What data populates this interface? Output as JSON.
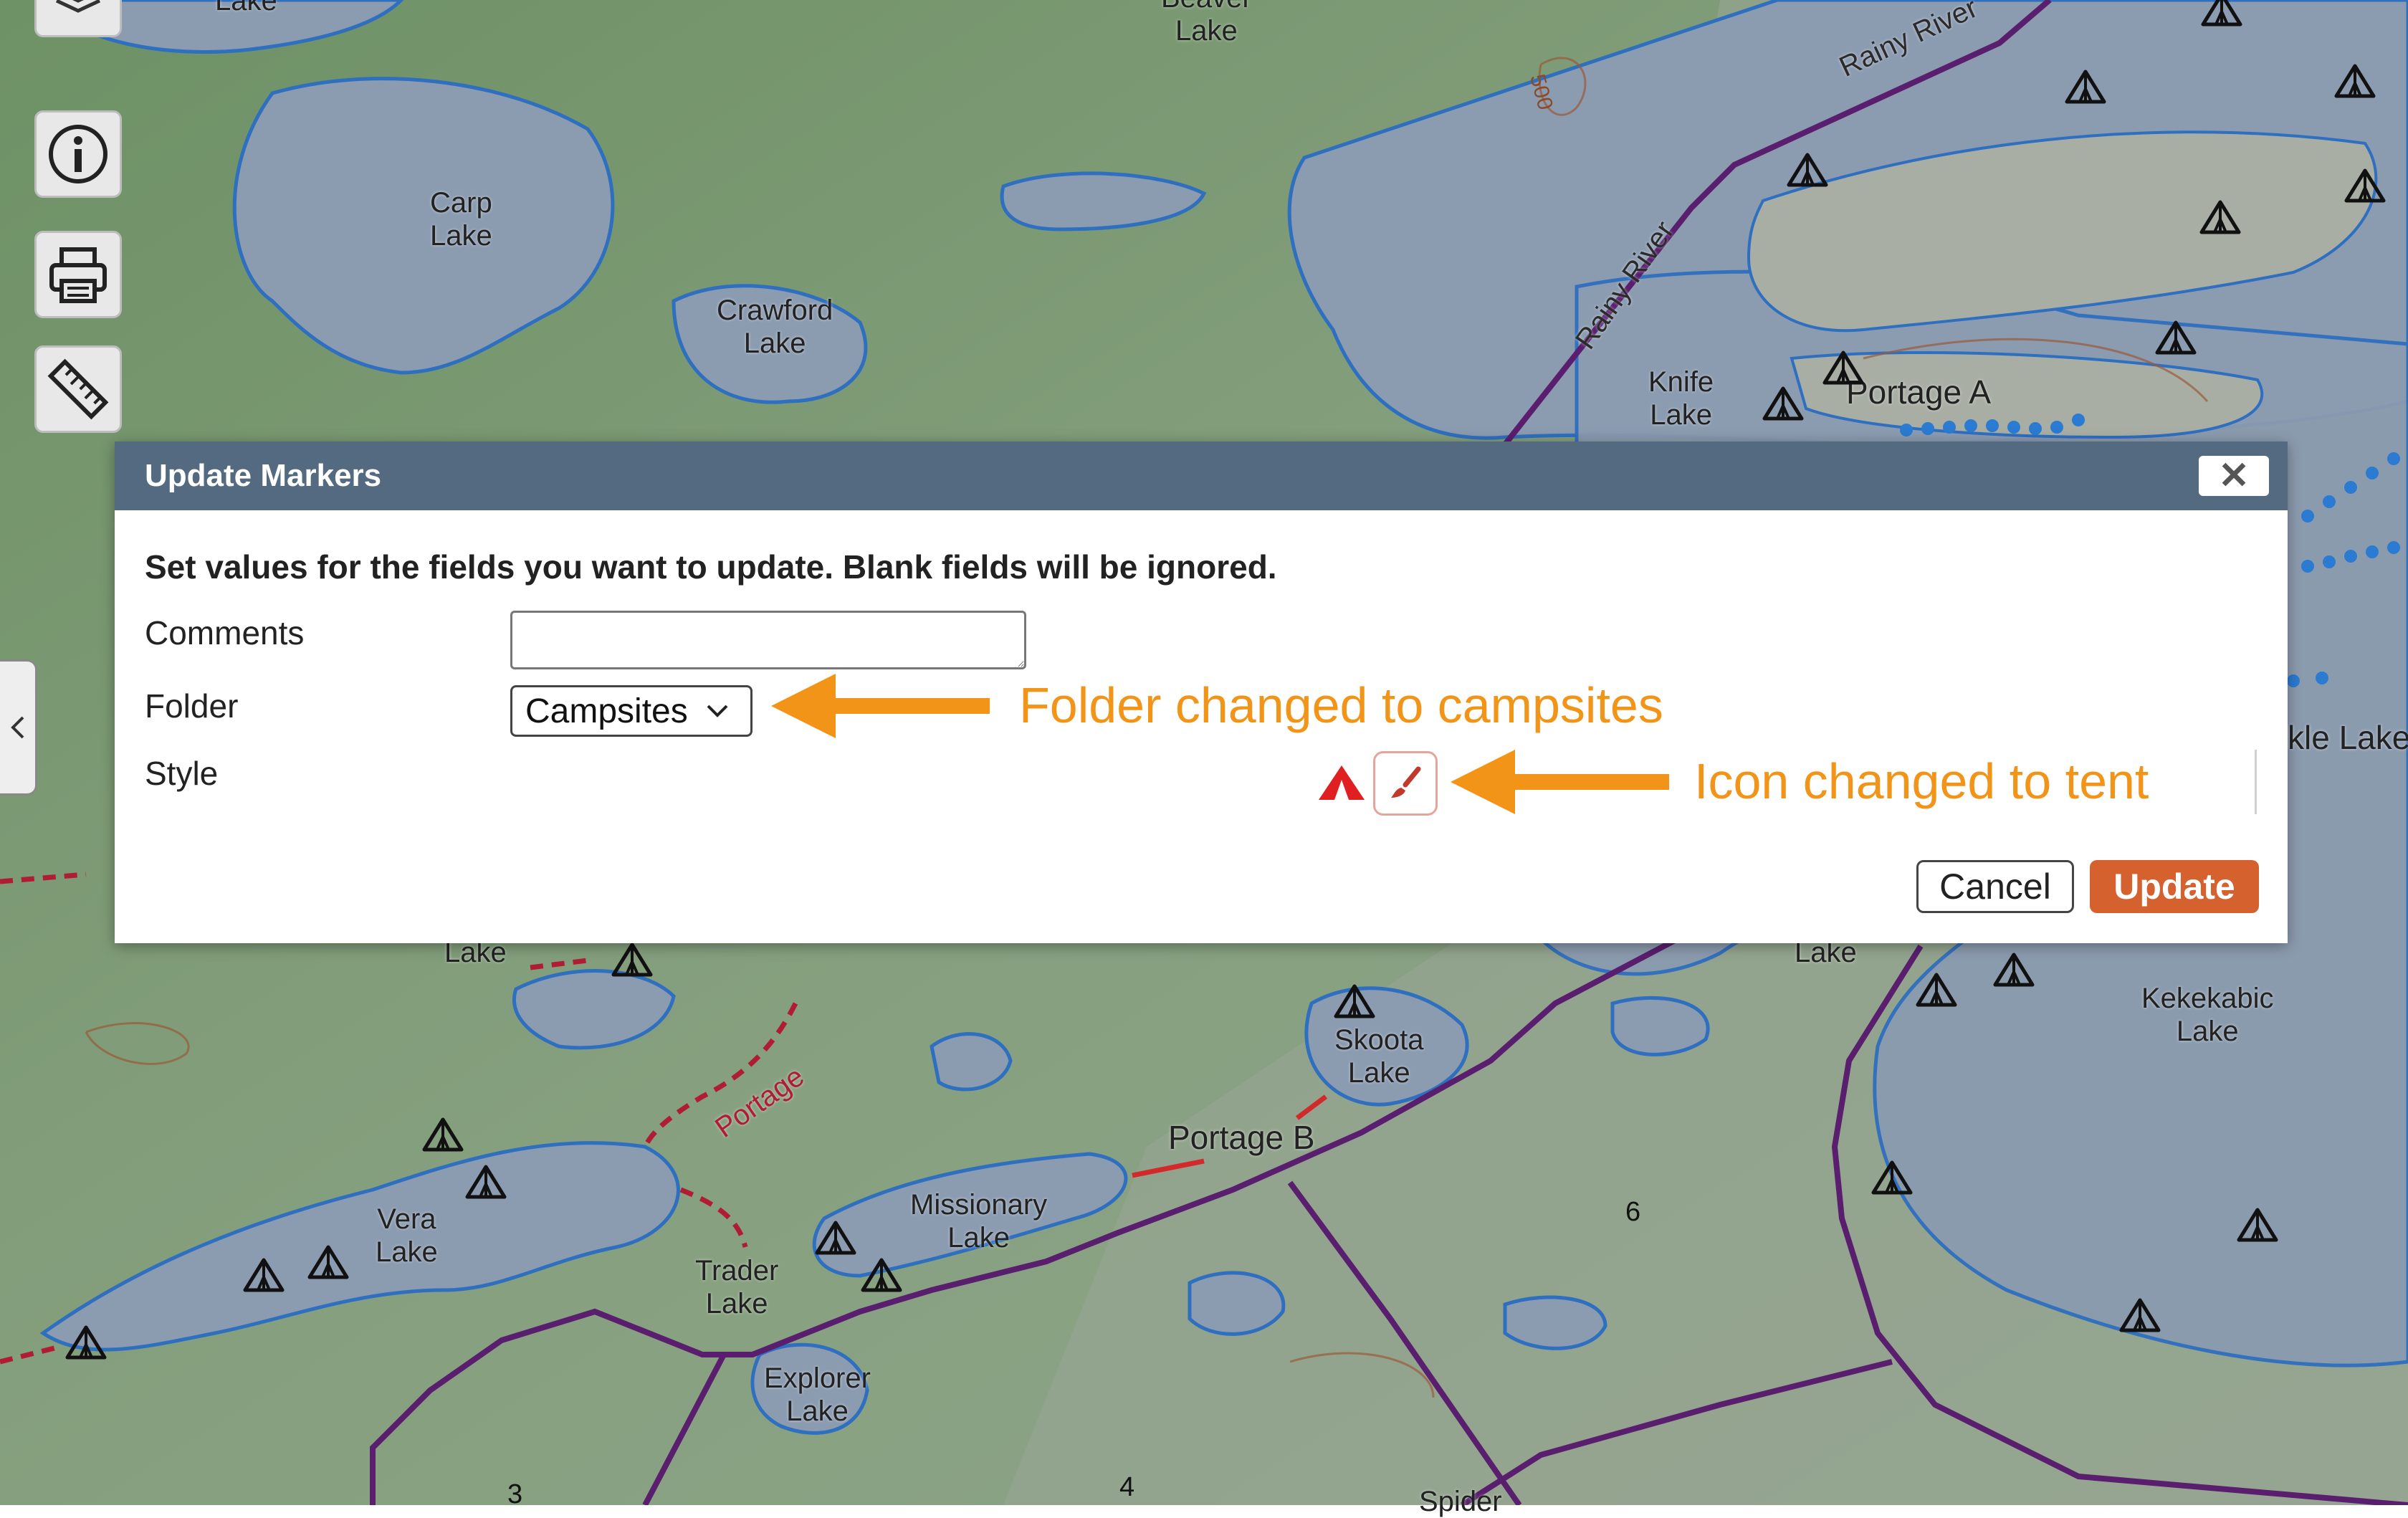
{
  "map": {
    "lake_labels": [
      {
        "id": "lake-beaver",
        "text": "Beaver\nLake"
      },
      {
        "id": "lake-top-left",
        "text": "Lake"
      },
      {
        "id": "lake-carp",
        "text": "Carp\nLake"
      },
      {
        "id": "lake-crawford",
        "text": "Crawford\nLake"
      },
      {
        "id": "lake-knife",
        "text": "Knife\nLake"
      },
      {
        "id": "lake-left-mid",
        "text": "Lake"
      },
      {
        "id": "lake-right-mid",
        "text": "Lake"
      },
      {
        "id": "lake-kekekabic",
        "text": "Kekekabic\nLake"
      },
      {
        "id": "lake-skoota",
        "text": "Skoota\nLake"
      },
      {
        "id": "lake-vera",
        "text": "Vera\nLake"
      },
      {
        "id": "lake-missionary",
        "text": "Missionary\nLake"
      },
      {
        "id": "lake-trader",
        "text": "Trader\nLake"
      },
      {
        "id": "lake-explorer",
        "text": "Explorer\nLake"
      },
      {
        "id": "lake-spider",
        "text": "Spider"
      },
      {
        "id": "lake-partial-right",
        "text": "kle Lake"
      }
    ],
    "river_labels": [
      "Rainy River",
      "Rainy River"
    ],
    "contour_label": "500",
    "portage_a": "Portage A",
    "portage_b": "Portage B",
    "portage_trail": "Portage",
    "section_numbers": [
      "6",
      "3",
      "4"
    ]
  },
  "controls": {
    "layers_icon": "layers-icon",
    "info_icon": "info-icon",
    "print_icon": "printer-icon",
    "measure_icon": "ruler-icon",
    "side_toggle_icon": "chevron-left-icon"
  },
  "dialog": {
    "title": "Update Markers",
    "close_label": "✕",
    "instructions": "Set values for the fields you want to update. Blank fields will be ignored.",
    "fields": {
      "comments_label": "Comments",
      "comments_value": "",
      "folder_label": "Folder",
      "folder_value": "Campsites",
      "style_label": "Style"
    },
    "cancel_label": "Cancel",
    "update_label": "Update"
  },
  "annotations": {
    "folder_note": "Folder changed to campsites",
    "icon_note": "Icon changed to tent"
  },
  "colors": {
    "land": "#7d9a78",
    "water": "#8b9bb0",
    "lake_outline": "#2f6fc0",
    "boundary": "#5a1e6e",
    "portage_red": "#c42a2a",
    "dialog_header": "#546a80",
    "update_button": "#d5612f",
    "annotation_orange": "#f29417"
  }
}
